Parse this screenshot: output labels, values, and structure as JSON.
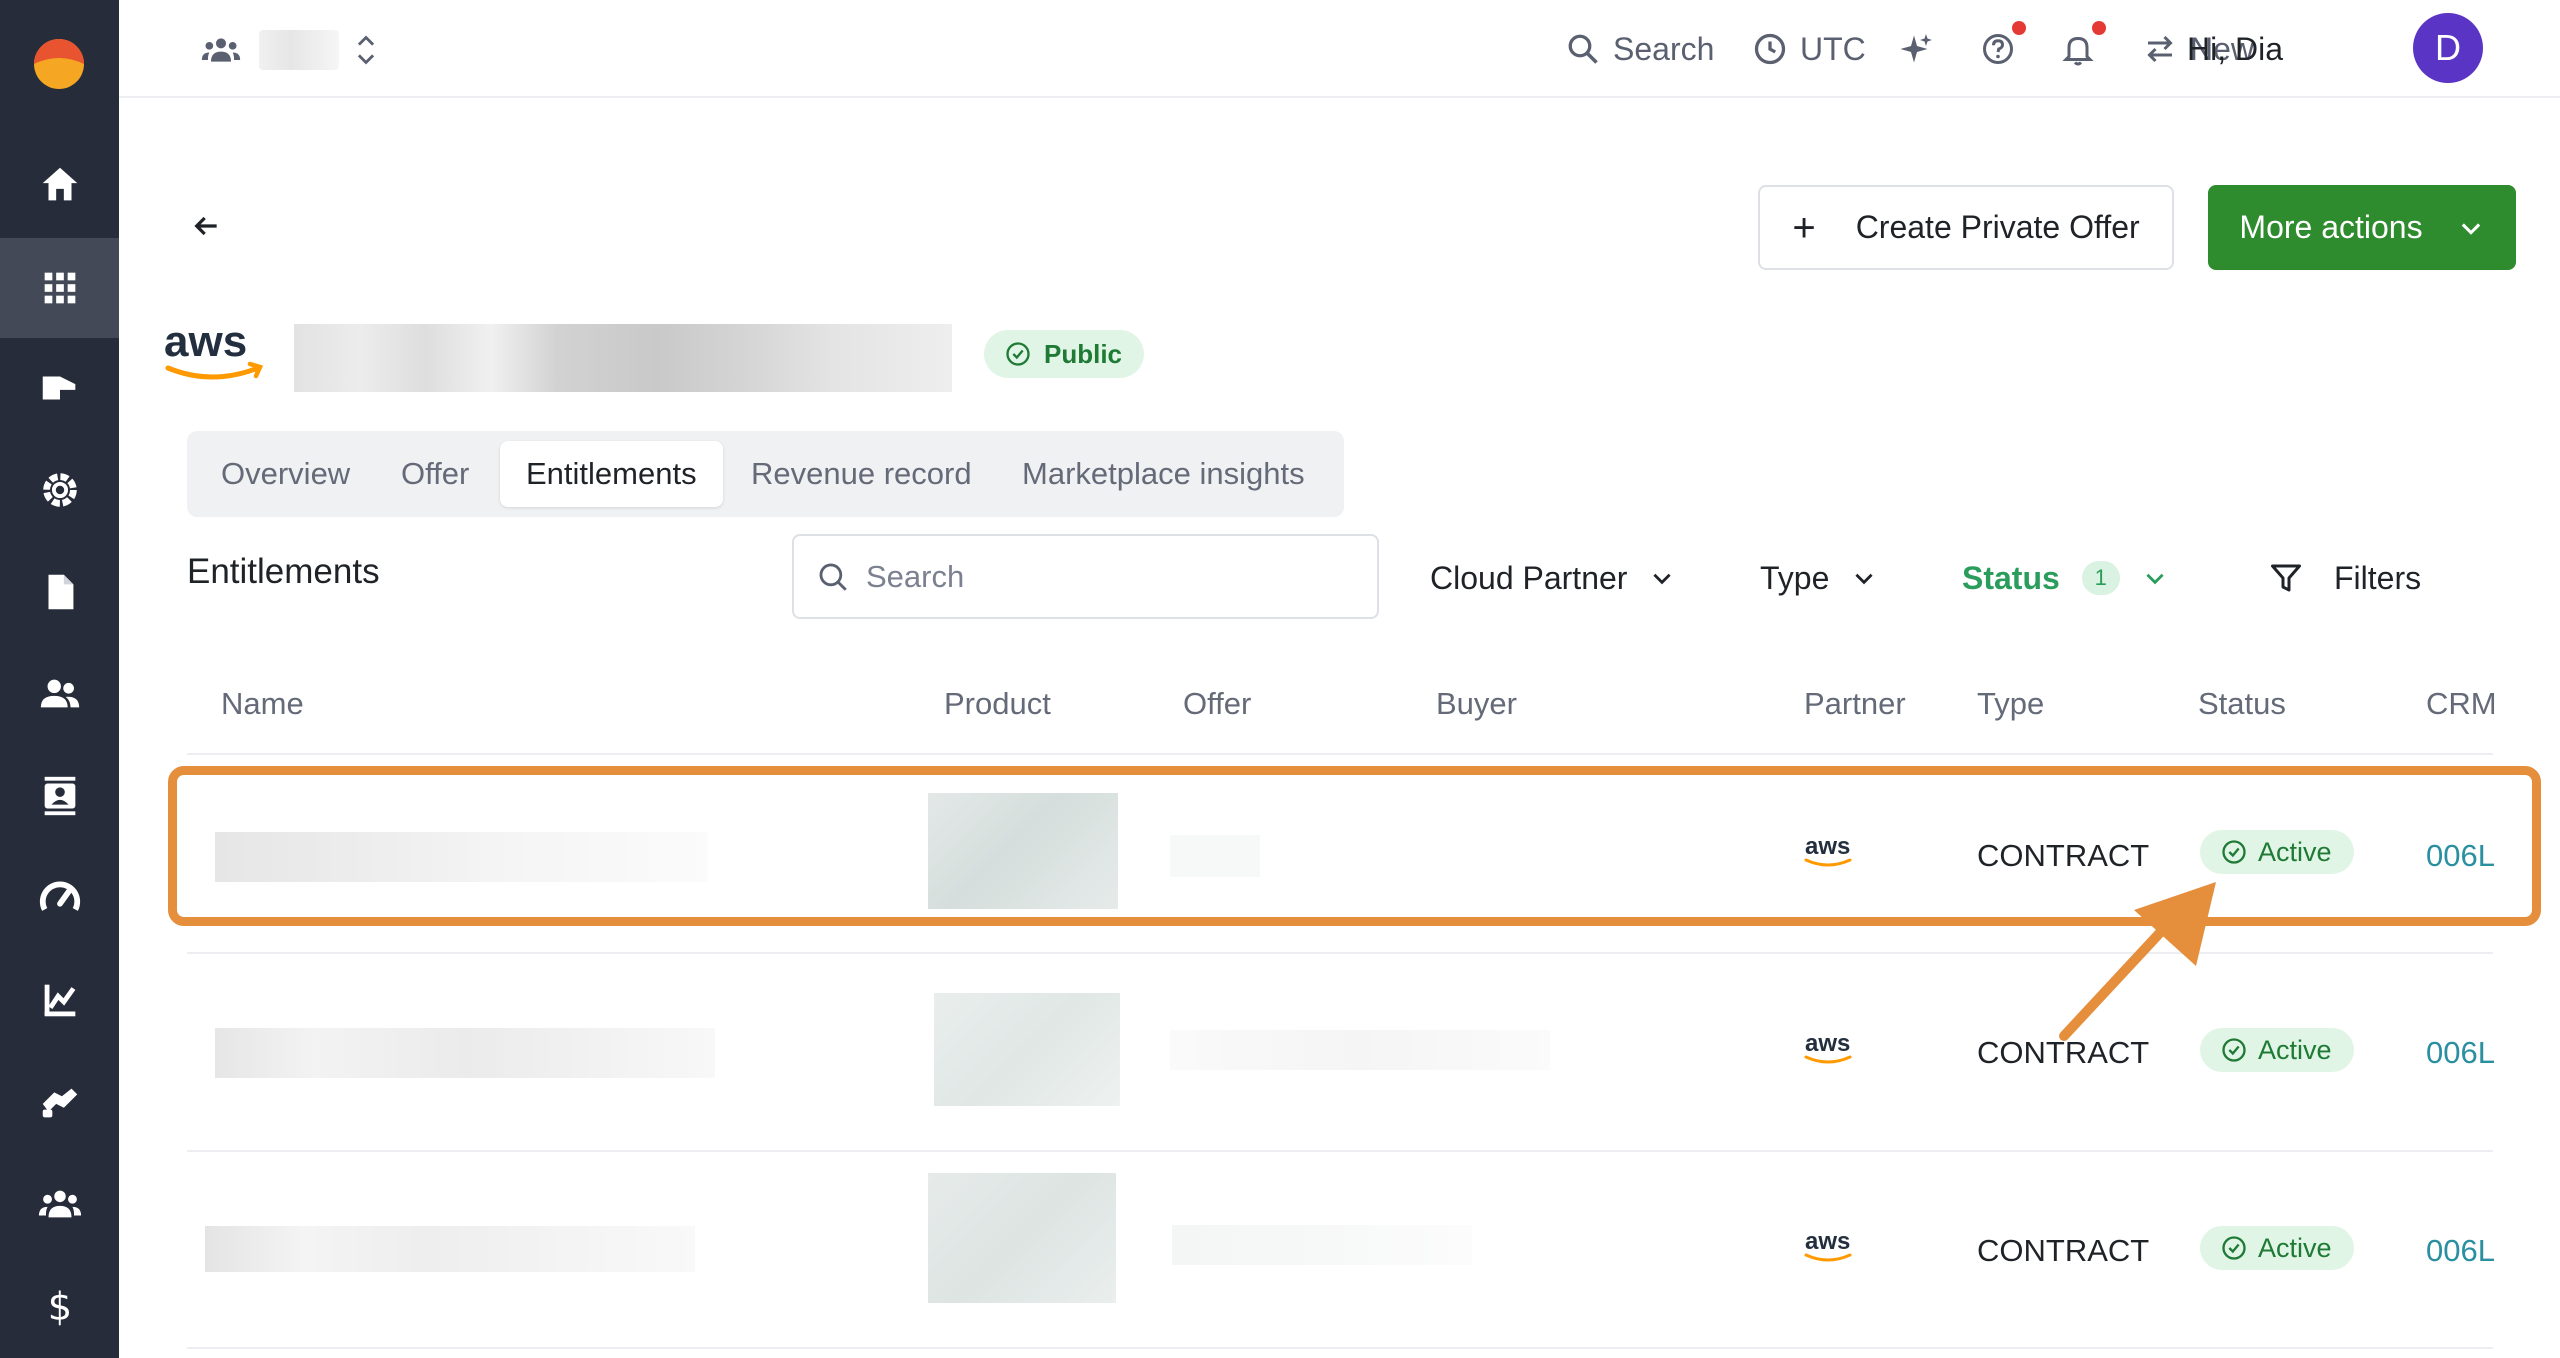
{
  "topbar": {
    "search_label": "Search",
    "timezone_label": "UTC",
    "new_label": "New",
    "greeting": "Hi, Dia",
    "avatar_initial": "D"
  },
  "header": {
    "create_offer_label": "Create Private Offer",
    "more_actions_label": "More actions",
    "status_badge": "Public"
  },
  "tabs": [
    {
      "label": "Overview"
    },
    {
      "label": "Offer"
    },
    {
      "label": "Entitlements"
    },
    {
      "label": "Revenue record"
    },
    {
      "label": "Marketplace insights"
    }
  ],
  "entitlements": {
    "section_title": "Entitlements",
    "search_placeholder": "Search",
    "filters": {
      "cloud_partner": "Cloud Partner",
      "type": "Type",
      "status": "Status",
      "status_count": "1",
      "filters": "Filters"
    },
    "columns": [
      "Name",
      "Product",
      "Offer",
      "Buyer",
      "Partner",
      "Type",
      "Status",
      "CRM"
    ],
    "rows": [
      {
        "type": "CONTRACT",
        "status": "Active",
        "crm": "006L"
      },
      {
        "type": "CONTRACT",
        "status": "Active",
        "crm": "006L"
      },
      {
        "type": "CONTRACT",
        "status": "Active",
        "crm": "006L"
      }
    ]
  },
  "colors": {
    "sidebar": "#272c3a",
    "primary_green": "#2e8b2e",
    "highlight_orange": "#e58e3b",
    "status_green": "#1e7a35",
    "avatar": "#5a34c4"
  }
}
